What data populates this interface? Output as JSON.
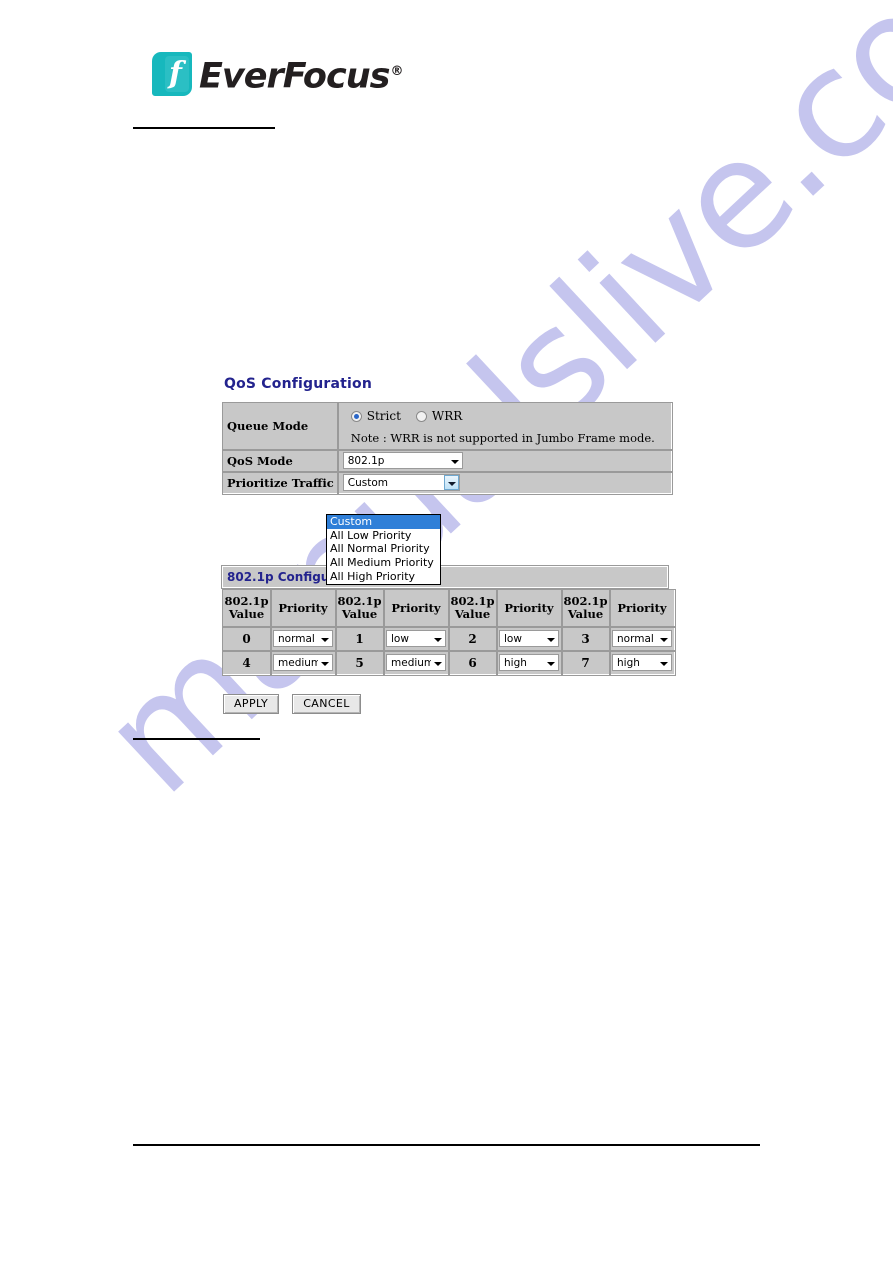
{
  "brand": {
    "logo_letter": "f",
    "name": "EverFocus",
    "registered_mark": "®"
  },
  "screenshot": {
    "section_title": "QoS Configuration",
    "queue_mode": {
      "label": "Queue Mode",
      "options": [
        {
          "label": "Strict",
          "selected": true
        },
        {
          "label": "WRR",
          "selected": false
        }
      ],
      "note": "Note : WRR is not supported in Jumbo Frame mode."
    },
    "qos_mode": {
      "label": "QoS Mode",
      "value": "802.1p"
    },
    "prioritize_traffic": {
      "label": "Prioritize Traffic",
      "value": "Custom",
      "open": true,
      "options": [
        "Custom",
        "All Low Priority",
        "All Normal Priority",
        "All Medium Priority",
        "All High Priority"
      ],
      "highlighted_option": "Custom"
    },
    "p8021p_section": {
      "title": "802.1p Configuration",
      "headers": [
        "802.1p Value",
        "Priority",
        "802.1p Value",
        "Priority",
        "802.1p Value",
        "Priority",
        "802.1p Value",
        "Priority"
      ],
      "header_line1": "802.1p",
      "header_line2": "Value",
      "header_priority": "Priority",
      "rows": [
        [
          {
            "value": "0",
            "priority": "normal"
          },
          {
            "value": "1",
            "priority": "low"
          },
          {
            "value": "2",
            "priority": "low"
          },
          {
            "value": "3",
            "priority": "normal"
          }
        ],
        [
          {
            "value": "4",
            "priority": "medium"
          },
          {
            "value": "5",
            "priority": "medium"
          },
          {
            "value": "6",
            "priority": "high"
          },
          {
            "value": "7",
            "priority": "high"
          }
        ]
      ]
    },
    "buttons": {
      "apply": "APPLY",
      "cancel": "CANCEL"
    }
  },
  "watermark": {
    "text": "manualslive.com",
    "color": "#c5c5ee"
  },
  "colors": {
    "heading_blue": "#23238e",
    "table_gray": "#c8c8c8",
    "highlight_blue": "#2f7fd8",
    "logo_teal": "#17b8bd"
  }
}
